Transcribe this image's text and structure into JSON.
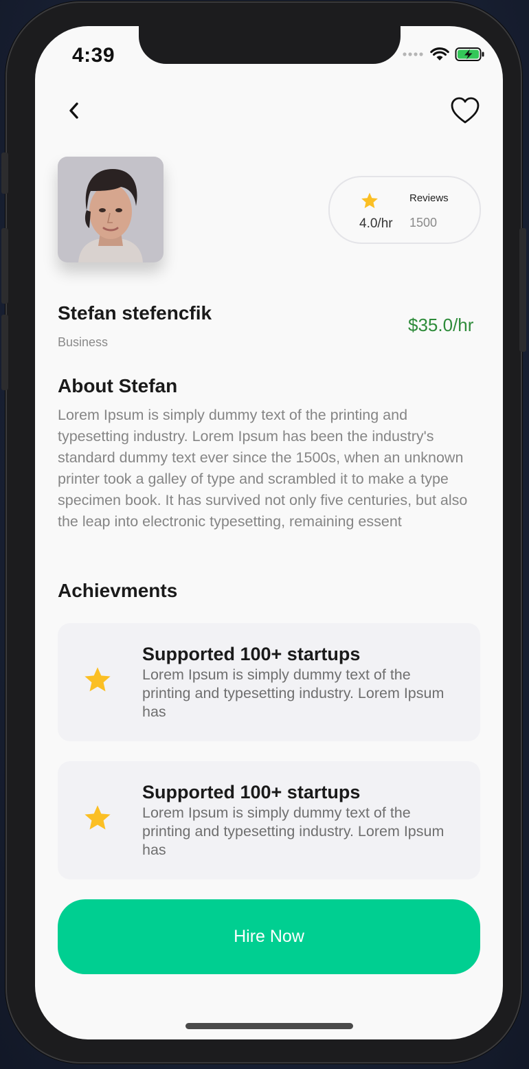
{
  "status_bar": {
    "time": "4:39"
  },
  "profile": {
    "name": "Stefan stefencfik",
    "category": "Business",
    "price": "$35.0/hr"
  },
  "rating": {
    "value": "4.0/hr",
    "reviews_label": "Reviews",
    "reviews_count": "1500"
  },
  "about": {
    "title": "About Stefan",
    "text": "Lorem Ipsum is simply dummy text of the printing and typesetting industry. Lorem Ipsum has been the industry's standard dummy text ever since the 1500s, when an unknown printer took a galley of type and scrambled it to make a type specimen book. It has survived not only five centuries, but also the leap into electronic typesetting, remaining essent"
  },
  "achievements": {
    "title": "Achievments",
    "items": [
      {
        "title": "Supported 100+ startups",
        "description": "Lorem Ipsum is simply dummy text of the printing and typesetting industry. Lorem Ipsum has"
      },
      {
        "title": "Supported 100+ startups",
        "description": "Lorem Ipsum is simply dummy text of the printing and typesetting industry. Lorem Ipsum has"
      }
    ]
  },
  "actions": {
    "hire_label": "Hire Now"
  },
  "icons": {
    "back": "chevron-left-icon",
    "favorite": "heart-outline-icon",
    "star": "star-icon",
    "wifi": "wifi-icon",
    "battery": "battery-charging-icon",
    "cellular": "cellular-signal-icon"
  },
  "colors": {
    "accent": "#00cf91",
    "price": "#2e8b3a",
    "star": "#fbbf24",
    "battery": "#34c759"
  }
}
